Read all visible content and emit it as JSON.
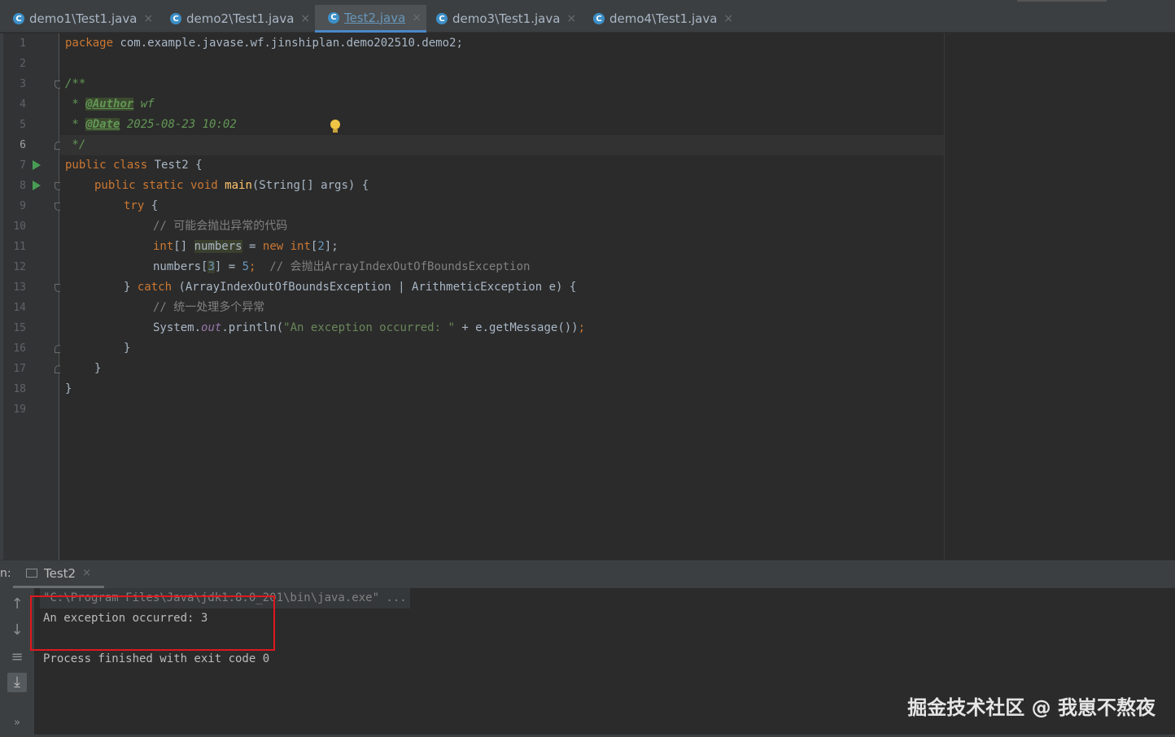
{
  "tabs": [
    {
      "label": "demo1\\Test1.java",
      "active": false
    },
    {
      "label": "demo2\\Test1.java",
      "active": false
    },
    {
      "label": "Test2.java",
      "active": true
    },
    {
      "label": "demo3\\Test1.java",
      "active": false
    },
    {
      "label": "demo4\\Test1.java",
      "active": false
    }
  ],
  "editor": {
    "line_numbers": [
      "1",
      "2",
      "3",
      "4",
      "5",
      "6",
      "7",
      "8",
      "9",
      "10",
      "11",
      "12",
      "13",
      "14",
      "15",
      "16",
      "17",
      "18",
      "19"
    ],
    "current_line": "6",
    "code": {
      "l1_kw": "package",
      "l1_rest": " com.example.javase.wf.jinshiplan.demo202510.demo2;",
      "l3": "/**",
      "l4_star": " * ",
      "l4_tag": "@Author",
      "l4_val": " wf",
      "l5_star": " * ",
      "l5_tag": "@Date",
      "l5_val": " 2025-08-23 10:02",
      "l6": " */",
      "l7_kw": "public class",
      "l7_rest": " Test2 {",
      "l8_kw": "public static void",
      "l8_fn": "main",
      "l8_rest": "(String[] args) {",
      "l9_kw": "try",
      "l9_rest": " {",
      "l10_comment": "// 可能会抛出异常的代码",
      "l11_type": "int",
      "l11_brk": "[] ",
      "l11_var": "numbers",
      "l11_eq": " = ",
      "l11_new": "new",
      "l11_int": " int",
      "l11_open": "[",
      "l11_num": "2",
      "l11_close": "];",
      "l12_a": "numbers[",
      "l12_idx": "3",
      "l12_b": "] = ",
      "l12_num": "5",
      "l12_semi": ";",
      "l12_comment": "  // 会抛出ArrayIndexOutOfBoundsException",
      "l13_a": "} ",
      "l13_kw": "catch",
      "l13_rest": " (ArrayIndexOutOfBoundsException | ArithmeticException e) {",
      "l14_comment": "// 统一处理多个异常",
      "l15_a": "System.",
      "l15_out": "out",
      "l15_b": ".println(",
      "l15_str": "\"An exception occurred: \"",
      "l15_c": " + e.getMessage())",
      "l15_semi": ";",
      "l16": "}",
      "l17": "}",
      "l18": "}"
    }
  },
  "run_panel": {
    "prefix": "n:",
    "tab_label": "Test2",
    "console": {
      "command": "\"C:\\Program Files\\Java\\jdk1.8.0_201\\bin\\java.exe\" ...",
      "output": "An exception occurred: 3",
      "finish": "Process finished with exit code 0"
    },
    "toolbar": [
      "up-arrow-icon",
      "down-arrow-icon",
      "soft-wrap-icon",
      "scroll-to-end-icon",
      "more-icon"
    ]
  },
  "watermark": "掘金技术社区 @ 我崽不熬夜",
  "colors": {
    "accent": "#4a88c7",
    "highlight_box": "#e0171e",
    "keyword": "#cc7832",
    "string": "#6a8759",
    "number": "#6897bb"
  }
}
